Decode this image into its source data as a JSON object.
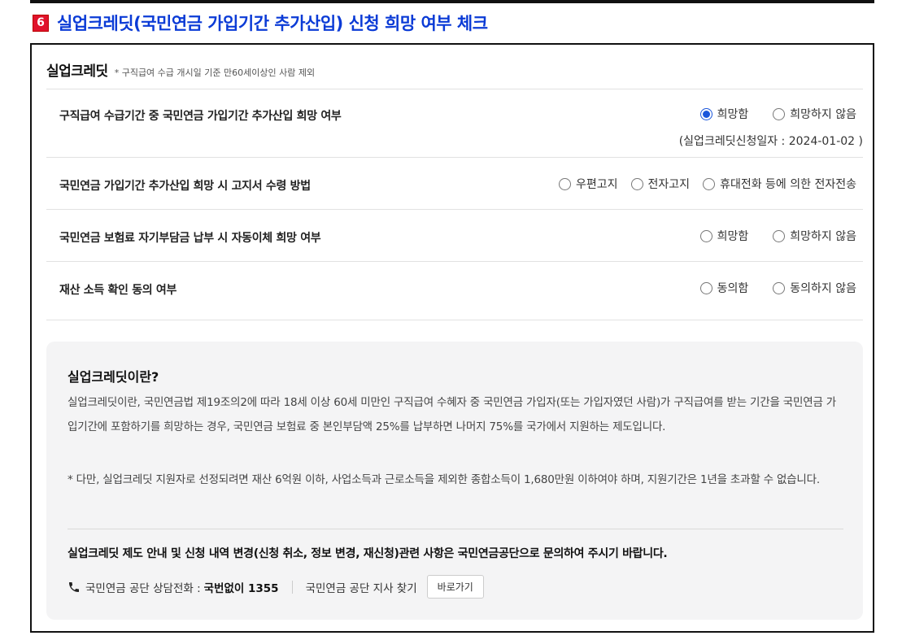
{
  "section": {
    "badge": "6",
    "title": "실업크레딧(국민연금 가입기간 추가산입) 신청 희망 여부 체크"
  },
  "card": {
    "title": "실업크레딧",
    "note": "* 구직급여 수급 개시일 기준 만60세이상인 사람 제외"
  },
  "questions": [
    {
      "label": "구직급여 수급기간 중 국민연금 가입기간 추가산입 희망 여부",
      "options": [
        {
          "label": "희망함",
          "checked": true
        },
        {
          "label": "희망하지 않음",
          "checked": false
        }
      ],
      "note": "(실업크레딧신청일자 : 2024-01-02 )"
    },
    {
      "label": "국민연금 가입기간 추가산입 희망 시 고지서 수령 방법",
      "options": [
        {
          "label": "우편고지",
          "checked": false
        },
        {
          "label": "전자고지",
          "checked": false
        },
        {
          "label": "휴대전화 등에 의한 전자전송",
          "checked": false
        }
      ]
    },
    {
      "label": "국민연금 보험료 자기부담금 납부 시 자동이체 희망 여부",
      "options": [
        {
          "label": "희망함",
          "checked": false
        },
        {
          "label": "희망하지 않음",
          "checked": false
        }
      ]
    },
    {
      "label": "재산 소득 확인 동의 여부",
      "options": [
        {
          "label": "동의함",
          "checked": false
        },
        {
          "label": "동의하지 않음",
          "checked": false
        }
      ]
    }
  ],
  "info": {
    "title": "실업크레딧이란?",
    "paragraph1": "실업크레딧이란, 국민연금법 제19조의2에 따라 18세 이상 60세 미만인 구직급여 수혜자 중 국민연금 가입자(또는 가입자였던 사람)가 구직급여를 받는 기간을 국민연금 가입기간에 포함하기를 희망하는 경우, 국민연금 보험료 중 본인부담액 25%를 납부하면 나머지 75%를 국가에서 지원하는 제도입니다.",
    "paragraph2": "* 다만, 실업크레딧 지원자로 선정되려면 재산 6억원 이하, 사업소득과 근로소득을 제외한 종합소득이 1,680만원 이하여야 하며, 지원기간은 1년을 초과할 수 없습니다.",
    "contact_title": "실업크레딧 제도 안내 및 신청 내역 변경(신청 취소, 정보 변경, 재신청)관련 사항은 국민연금공단으로 문의하여 주시기 바랍니다.",
    "phone_label": "국민연금 공단 상담전화 :",
    "phone_number": "국번없이 1355",
    "branch_label": "국민연금 공단 지사 찾기",
    "goto_button": "바로가기"
  },
  "colors": {
    "title_blue": "#0b3bd6",
    "badge_red": "#e0122b",
    "radio_blue": "#1a56db"
  }
}
